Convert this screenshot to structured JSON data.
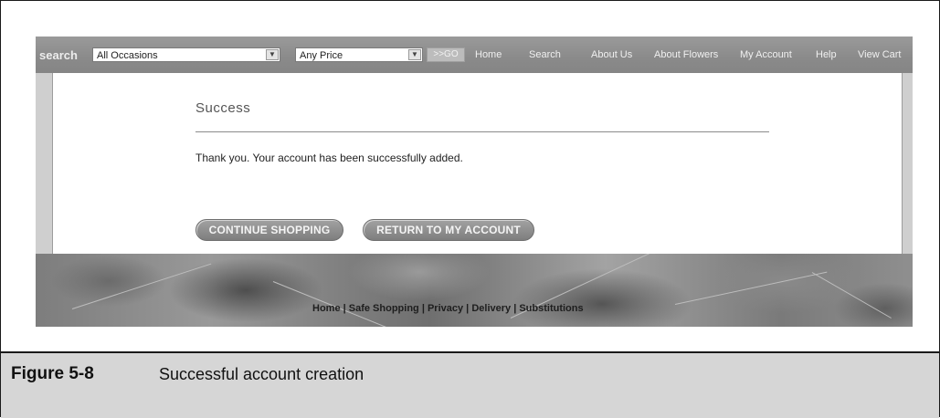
{
  "navbar": {
    "brand": "search",
    "occasion_select": "All Occasions",
    "price_select": "Any Price",
    "go_label": ">>GO",
    "links": [
      "Home",
      "Search",
      "About Us",
      "About Flowers",
      "My Account",
      "Help",
      "View Cart"
    ]
  },
  "content": {
    "title": "Success",
    "message": "Thank you. Your account has been successfully added.",
    "continue_button": "CONTINUE SHOPPING",
    "return_button": "RETURN TO MY ACCOUNT"
  },
  "footer": {
    "links": [
      "Home",
      "Safe Shopping",
      "Privacy",
      "Delivery",
      "Substitutions"
    ],
    "separator": " | "
  },
  "caption": {
    "label": "Figure 5-8",
    "text": "Successful account creation"
  }
}
